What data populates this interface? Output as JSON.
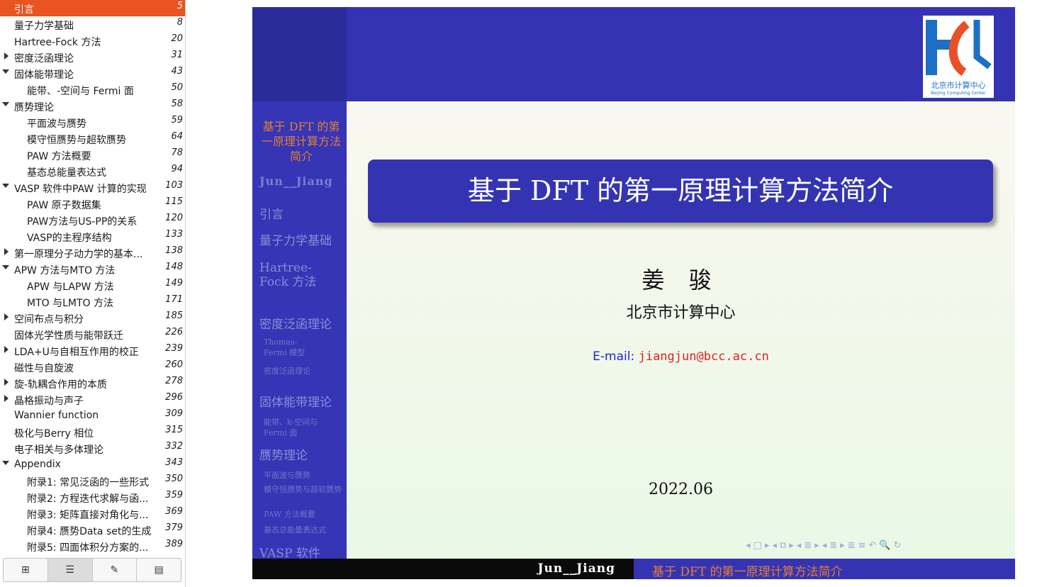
{
  "outline": {
    "items": [
      {
        "label": "引言",
        "page": "5",
        "level": 0,
        "toggle": "none",
        "selected": true
      },
      {
        "label": "量子力学基础",
        "page": "8",
        "level": 0,
        "toggle": "none"
      },
      {
        "label": "Hartree-Fock 方法",
        "page": "20",
        "level": 0,
        "toggle": "none"
      },
      {
        "label": "密度泛函理论",
        "page": "31",
        "level": 0,
        "toggle": "closed"
      },
      {
        "label": "固体能带理论",
        "page": "43",
        "level": 0,
        "toggle": "open"
      },
      {
        "label": "能带、-空间与 Fermi 面",
        "page": "50",
        "level": 1,
        "toggle": "none"
      },
      {
        "label": "赝势理论",
        "page": "58",
        "level": 0,
        "toggle": "open"
      },
      {
        "label": "平面波与赝势",
        "page": "59",
        "level": 1,
        "toggle": "none"
      },
      {
        "label": "模守恒赝势与超软赝势",
        "page": "64",
        "level": 1,
        "toggle": "none"
      },
      {
        "label": "PAW 方法概要",
        "page": "78",
        "level": 1,
        "toggle": "none"
      },
      {
        "label": "基态总能量表达式",
        "page": "94",
        "level": 1,
        "toggle": "none"
      },
      {
        "label": "VASP 软件中PAW 计算的实现",
        "page": "103",
        "level": 0,
        "toggle": "open"
      },
      {
        "label": "PAW 原子数据集",
        "page": "115",
        "level": 1,
        "toggle": "none"
      },
      {
        "label": "PAW方法与US-PP的关系",
        "page": "120",
        "level": 1,
        "toggle": "none"
      },
      {
        "label": "VASP的主程序结构",
        "page": "133",
        "level": 1,
        "toggle": "none"
      },
      {
        "label": "第一原理分子动力学的基本...",
        "page": "138",
        "level": 0,
        "toggle": "closed"
      },
      {
        "label": "APW 方法与MTO 方法",
        "page": "148",
        "level": 0,
        "toggle": "open"
      },
      {
        "label": "APW 与LAPW 方法",
        "page": "149",
        "level": 1,
        "toggle": "none"
      },
      {
        "label": "MTO 与LMTO 方法",
        "page": "171",
        "level": 1,
        "toggle": "none"
      },
      {
        "label": " 空间布点与积分",
        "page": "185",
        "level": 0,
        "toggle": "closed"
      },
      {
        "label": "固体光学性质与能带跃迁",
        "page": "226",
        "level": 0,
        "toggle": "none"
      },
      {
        "label": "LDA+U与自相互作用的校正",
        "page": "239",
        "level": 0,
        "toggle": "closed"
      },
      {
        "label": "磁性与自旋波",
        "page": "260",
        "level": 0,
        "toggle": "none"
      },
      {
        "label": "旋-轨耦合作用的本质",
        "page": "278",
        "level": 0,
        "toggle": "closed"
      },
      {
        "label": "晶格振动与声子",
        "page": "296",
        "level": 0,
        "toggle": "closed"
      },
      {
        "label": "Wannier function",
        "page": "309",
        "level": 0,
        "toggle": "none"
      },
      {
        "label": "极化与Berry 相位",
        "page": "315",
        "level": 0,
        "toggle": "none"
      },
      {
        "label": "电子相关与多体理论",
        "page": "332",
        "level": 0,
        "toggle": "none"
      },
      {
        "label": "Appendix",
        "page": "343",
        "level": 0,
        "toggle": "open"
      },
      {
        "label": "附录1: 常见泛函的一些形式",
        "page": "350",
        "level": 1,
        "toggle": "none"
      },
      {
        "label": "附录2: 方程迭代求解与函...",
        "page": "359",
        "level": 1,
        "toggle": "none"
      },
      {
        "label": "附录3: 矩阵直接对角化与...",
        "page": "369",
        "level": 1,
        "toggle": "none"
      },
      {
        "label": "附录4: 赝势Data set的生成",
        "page": "379",
        "level": 1,
        "toggle": "none"
      },
      {
        "label": "附录5: 四面体积分方案的...",
        "page": "389",
        "level": 1,
        "toggle": "none"
      }
    ],
    "tabs": [
      {
        "icon": "thumbnails-icon",
        "glyph": "⊞"
      },
      {
        "icon": "outline-icon",
        "glyph": "☰"
      },
      {
        "icon": "annotations-icon",
        "glyph": "✎"
      },
      {
        "icon": "bookmarks-icon",
        "glyph": "▤"
      }
    ]
  },
  "slide": {
    "sidebar_title": "基于 DFT 的第一原理计算方法简介",
    "sidebar_author": "Jun__Jiang",
    "nav": [
      {
        "text": "引言",
        "kind": "sec"
      },
      {
        "text": "量子力学基础",
        "kind": "sec"
      },
      {
        "text": "Hartree-Fock 方法",
        "kind": "sec"
      },
      {
        "text": "密度泛函理论",
        "kind": "sec"
      },
      {
        "text": "Thomas-Fermi 模型",
        "kind": "sub"
      },
      {
        "text": "密度泛函理论",
        "kind": "sub"
      },
      {
        "text": "固体能带理论",
        "kind": "sec"
      },
      {
        "text": "能带、k-空间与 Fermi 面",
        "kind": "sub"
      },
      {
        "text": "赝势理论",
        "kind": "sec"
      },
      {
        "text": "平面波与赝势",
        "kind": "sub"
      },
      {
        "text": "模守恒赝势与超软赝势",
        "kind": "sub"
      },
      {
        "text": "PAW 方法概要",
        "kind": "sub"
      },
      {
        "text": "基态总能量表达式",
        "kind": "sub"
      },
      {
        "text": "VASP 软件",
        "kind": "sec"
      }
    ],
    "logo_text": "北京市计算中心",
    "logo_text_en": "Beijing Computing Center",
    "title": "基于 DFT 的第一原理计算方法简介",
    "author": "姜 骏",
    "institute": "北京市计算中心",
    "email_label": "E-mail:",
    "email": "jiangjun@bcc.ac.cn",
    "date": "2022.06",
    "footer_left": "Jun__Jiang",
    "footer_right": "基于 DFT 的第一原理计算方法简介",
    "nav_symbols": [
      "◂",
      "□",
      "▸",
      "◂",
      "⧉",
      "▸",
      "◂",
      "≣",
      "▸",
      "◂",
      "≣",
      "▸",
      "≣",
      "≡",
      "↶",
      "🔍",
      "↻"
    ],
    "colors": {
      "accent": "#e95420",
      "beamer_blue": "#3434b2",
      "beamer_orange": "#e57d35",
      "email_red": "#dd2222"
    }
  }
}
